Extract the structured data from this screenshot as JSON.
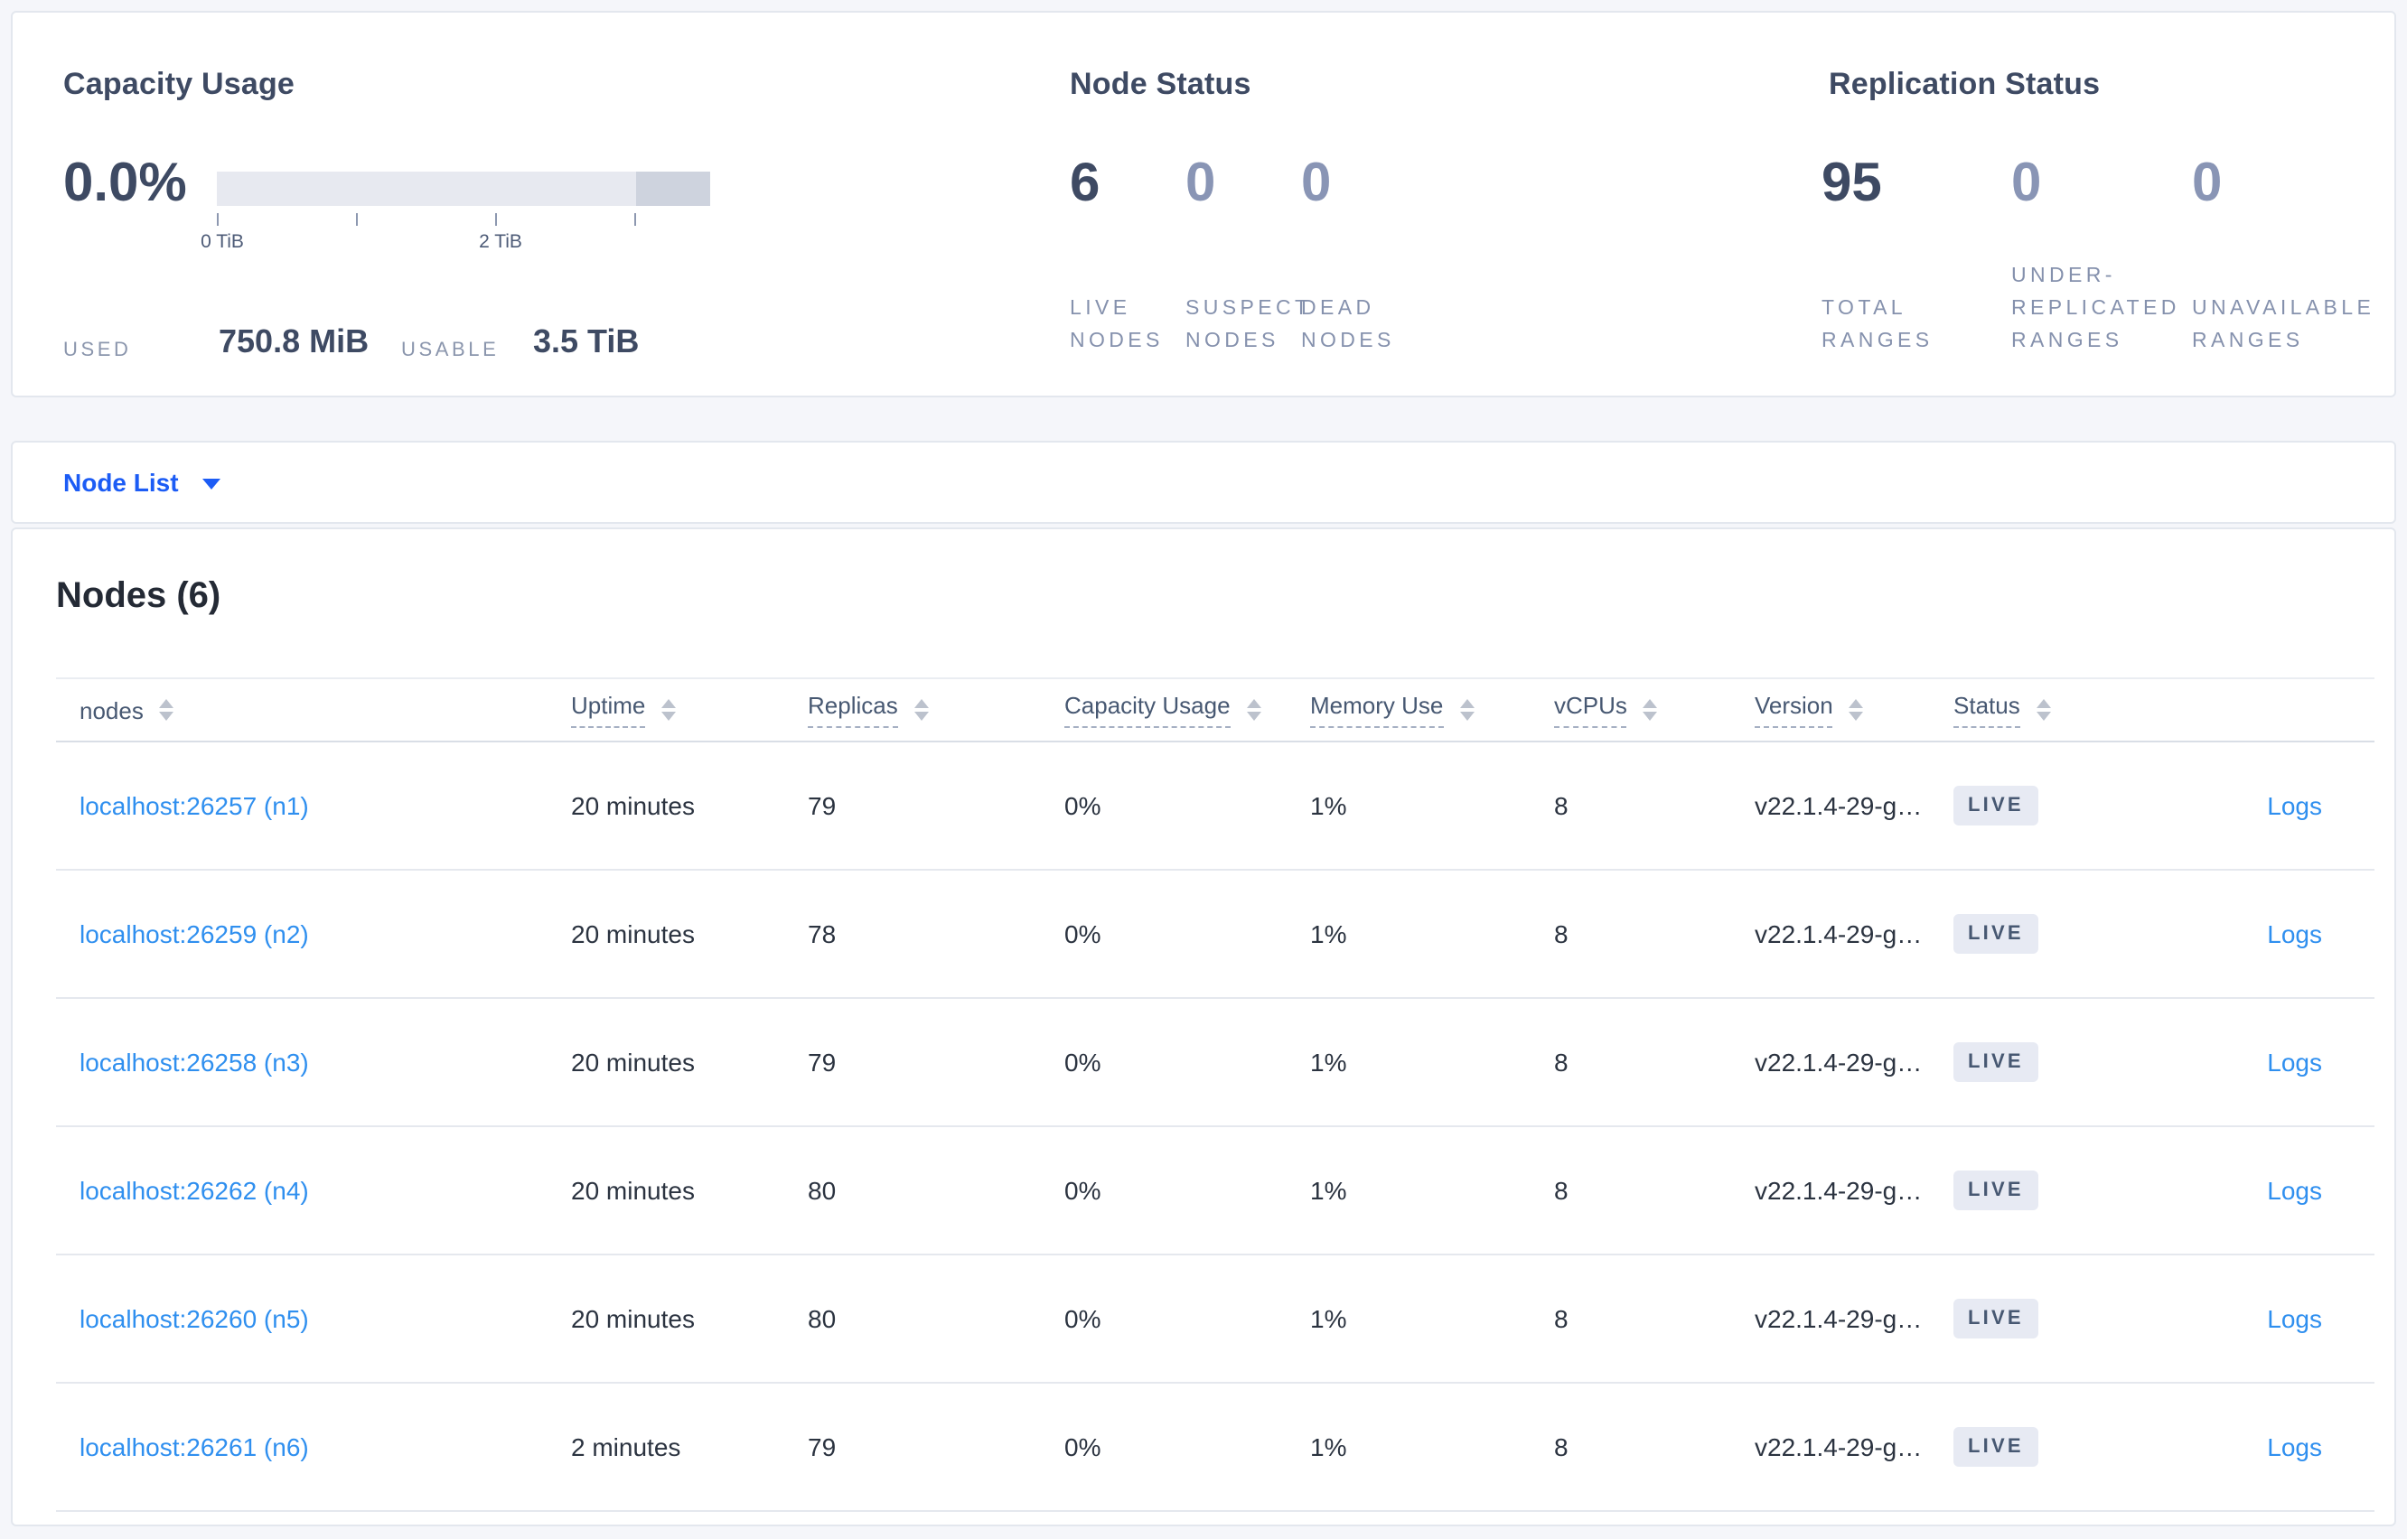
{
  "summary": {
    "capacity": {
      "title": "Capacity Usage",
      "percent": "0.0%",
      "tick_labels": [
        "0 TiB",
        "2 TiB"
      ],
      "used_label": "USED",
      "used_value": "750.8 MiB",
      "usable_label": "USABLE",
      "usable_value": "3.5 TiB"
    },
    "node_status": {
      "title": "Node Status",
      "stats": [
        {
          "value": "6",
          "label": "LIVE\nNODES"
        },
        {
          "value": "0",
          "label": "SUSPECT\nNODES"
        },
        {
          "value": "0",
          "label": "DEAD\nNODES"
        }
      ]
    },
    "replication_status": {
      "title": "Replication Status",
      "stats": [
        {
          "value": "95",
          "label": "TOTAL\nRANGES"
        },
        {
          "value": "0",
          "label": "UNDER-\nREPLICATED\nRANGES"
        },
        {
          "value": "0",
          "label": "UNAVAILABLE\nRANGES"
        }
      ]
    }
  },
  "node_list": {
    "label": "Node List"
  },
  "nodes_table": {
    "title": "Nodes (6)",
    "logs_label": "Logs",
    "columns": [
      {
        "label": "nodes"
      },
      {
        "label": "Uptime"
      },
      {
        "label": "Replicas"
      },
      {
        "label": "Capacity Usage"
      },
      {
        "label": "Memory Use"
      },
      {
        "label": "vCPUs"
      },
      {
        "label": "Version"
      },
      {
        "label": "Status"
      }
    ],
    "rows": [
      {
        "node": "localhost:26257 (n1)",
        "uptime": "20 minutes",
        "replicas": "79",
        "capacity": "0%",
        "memory": "1%",
        "vcpus": "8",
        "version": "v22.1.4-29-g…",
        "status": "LIVE"
      },
      {
        "node": "localhost:26259 (n2)",
        "uptime": "20 minutes",
        "replicas": "78",
        "capacity": "0%",
        "memory": "1%",
        "vcpus": "8",
        "version": "v22.1.4-29-g…",
        "status": "LIVE"
      },
      {
        "node": "localhost:26258 (n3)",
        "uptime": "20 minutes",
        "replicas": "79",
        "capacity": "0%",
        "memory": "1%",
        "vcpus": "8",
        "version": "v22.1.4-29-g…",
        "status": "LIVE"
      },
      {
        "node": "localhost:26262 (n4)",
        "uptime": "20 minutes",
        "replicas": "80",
        "capacity": "0%",
        "memory": "1%",
        "vcpus": "8",
        "version": "v22.1.4-29-g…",
        "status": "LIVE"
      },
      {
        "node": "localhost:26260 (n5)",
        "uptime": "20 minutes",
        "replicas": "80",
        "capacity": "0%",
        "memory": "1%",
        "vcpus": "8",
        "version": "v22.1.4-29-g…",
        "status": "LIVE"
      },
      {
        "node": "localhost:26261 (n6)",
        "uptime": "2 minutes",
        "replicas": "79",
        "capacity": "0%",
        "memory": "1%",
        "vcpus": "8",
        "version": "v22.1.4-29-g…",
        "status": "LIVE"
      }
    ]
  },
  "colors": {
    "accent_blue": "#1c5cf5",
    "link_blue": "#2f8fef",
    "heading_slate": "#3e4a63",
    "muted_slate": "#8995b5",
    "badge_bg": "#e7eaf3",
    "page_bg": "#f5f6fa"
  }
}
